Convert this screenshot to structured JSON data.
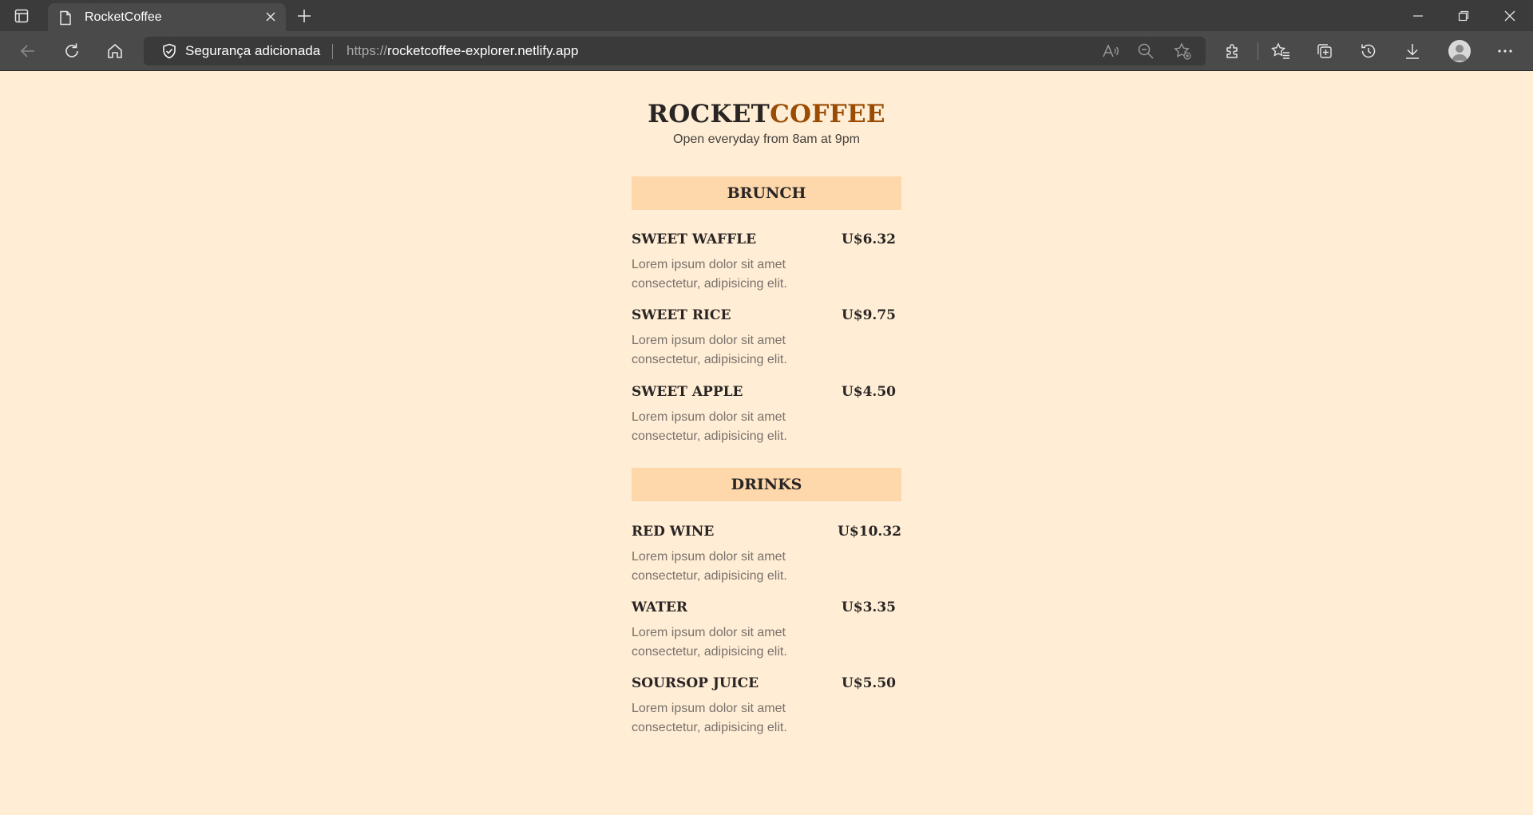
{
  "browser": {
    "tab_title": "RocketCoffee",
    "security_label": "Segurança adicionada",
    "url_protocol": "https://",
    "url_host": "rocketcoffee-explorer.netlify.app"
  },
  "header": {
    "brand_part1": "ROCKET",
    "brand_part2": "COFFEE",
    "hours": "Open everyday from 8am at 9pm"
  },
  "sections": [
    {
      "title": "BRUNCH",
      "items": [
        {
          "name": "SWEET WAFFLE",
          "price": "U$6.32",
          "desc": "Lorem ipsum dolor sit amet consectetur, adipisicing elit."
        },
        {
          "name": "SWEET RICE",
          "price": "U$9.75",
          "desc": "Lorem ipsum dolor sit amet consectetur, adipisicing elit."
        },
        {
          "name": "SWEET APPLE",
          "price": "U$4.50",
          "desc": "Lorem ipsum dolor sit amet consectetur, adipisicing elit."
        }
      ]
    },
    {
      "title": "DRINKS",
      "items": [
        {
          "name": "RED WINE",
          "price": "U$10.32",
          "desc": "Lorem ipsum dolor sit amet consectetur, adipisicing elit."
        },
        {
          "name": "WATER",
          "price": "U$3.35",
          "desc": "Lorem ipsum dolor sit amet consectetur, adipisicing elit."
        },
        {
          "name": "SOURSOP JUICE",
          "price": "U$5.50",
          "desc": "Lorem ipsum dolor sit amet consectetur, adipisicing elit."
        }
      ]
    }
  ],
  "colors": {
    "page_bg": "#FFEDD5",
    "section_bg": "#FED7AA",
    "accent": "#9A4B04",
    "text": "#292524",
    "muted": "#78716C"
  }
}
